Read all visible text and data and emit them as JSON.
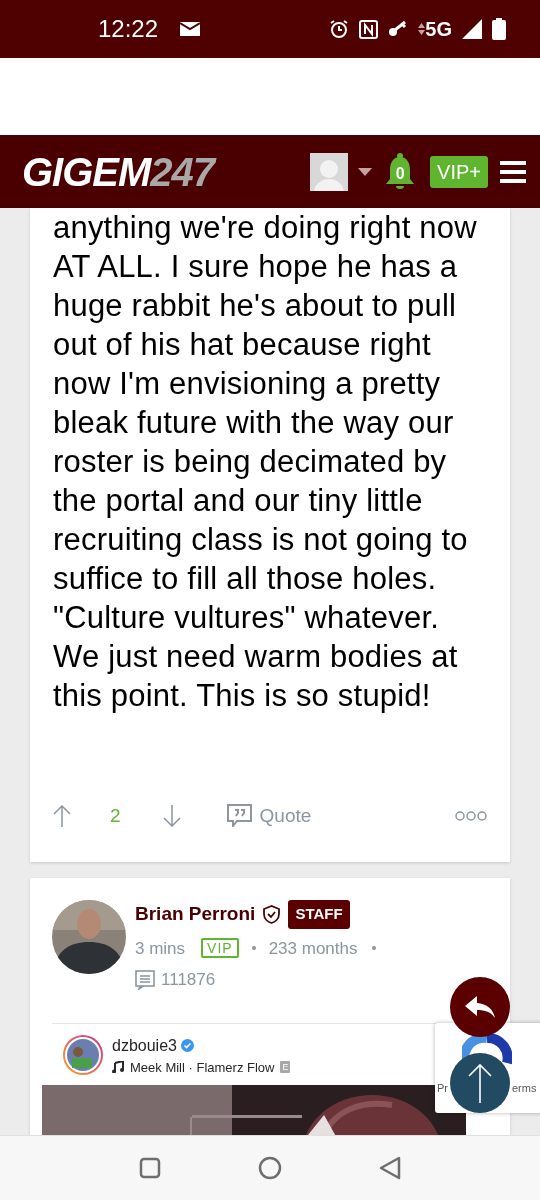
{
  "status_bar": {
    "time": "12:22",
    "network": "5G"
  },
  "header": {
    "logo_main": "GIGEM",
    "logo_accent": "247",
    "notifications": "0",
    "vip_button": "VIP+"
  },
  "post": {
    "body": "anything we're doing right now AT ALL. I sure hope he has a huge rabbit he's about to pull out of his hat because right now I'm envisioning a pretty bleak future with the way our roster is being decimated by the portal and our tiny little recruiting class is not going to suffice to fill all those holes. \"Culture vultures\" whatever. We just need warm bodies at this point. This is so stupid!",
    "votes": "2",
    "quote": "Quote"
  },
  "reply": {
    "author": "Brian Perroni",
    "badge": "STAFF",
    "time": "3 mins",
    "vip": "VIP",
    "tenure": "233 months",
    "post_count": "111876",
    "embed": {
      "username": "dzbouie3",
      "verified": true,
      "song": "Meek Mill · Flamerz Flow",
      "explicit": "E"
    }
  },
  "recaptcha": {
    "left_text": "Pr",
    "right_text": "erms"
  }
}
